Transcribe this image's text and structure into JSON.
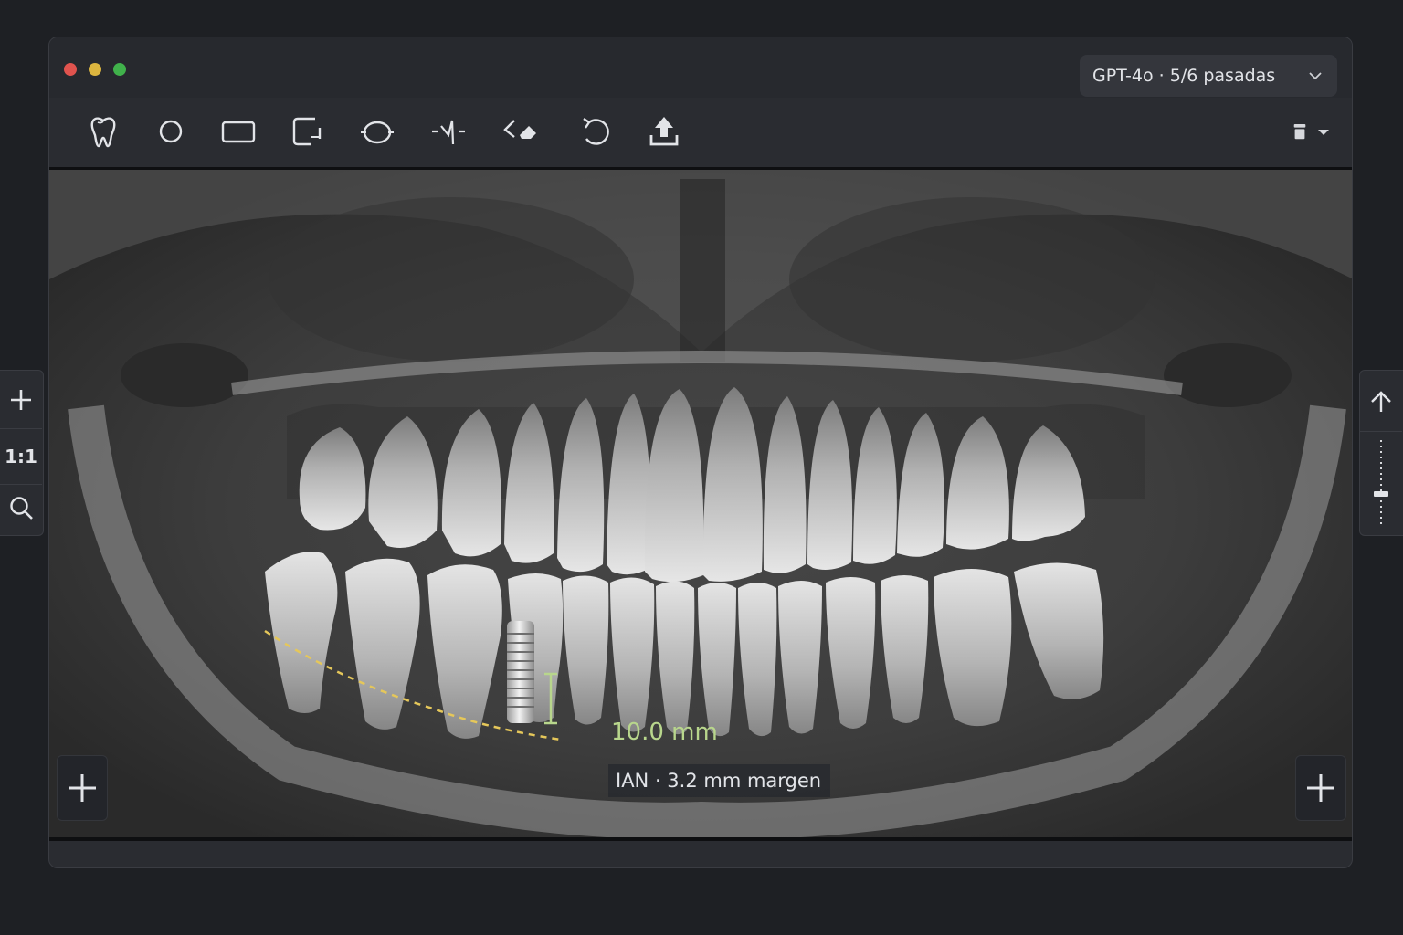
{
  "window": {
    "traffic_lights": [
      "close",
      "minimize",
      "zoom"
    ]
  },
  "model_selector": {
    "value": "GPT-4o · 5/6 pasadas",
    "icon": "chevron-down-icon"
  },
  "toolbar": {
    "tools": [
      {
        "name": "tooth-icon"
      },
      {
        "name": "circle-icon"
      },
      {
        "name": "rectangle-icon"
      },
      {
        "name": "crop-icon"
      },
      {
        "name": "ellipse-rotate-icon"
      },
      {
        "name": "nerve-path-icon"
      },
      {
        "name": "eraser-icon"
      },
      {
        "name": "undo-icon"
      },
      {
        "name": "export-icon"
      }
    ],
    "right_menu": {
      "icon": "trash-icon",
      "dropdown": "caret-down-icon"
    }
  },
  "left_rail": {
    "zoom_in": "plus-icon",
    "ratio_label": "1:1",
    "search": "magnifier-icon"
  },
  "right_rail": {
    "up": "arrow-up-icon",
    "slider": "vertical-slider"
  },
  "overlays": {
    "implant_length": "10.0 mm",
    "ian_label": "IAN · 3.2 mm margen"
  },
  "colors": {
    "accent_measure": "#b8d68c",
    "nerve_path": "#e5c75a",
    "window_bg": "#2a2c31"
  }
}
